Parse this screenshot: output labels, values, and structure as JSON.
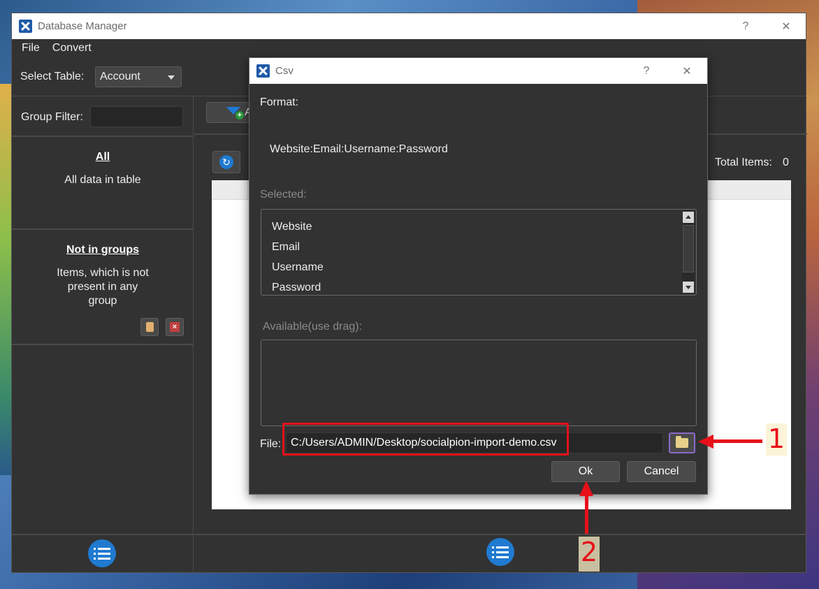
{
  "main_window": {
    "title": "Database Manager",
    "help": "?",
    "close": "✕",
    "menu": [
      "File",
      "Convert"
    ],
    "select_table_label": "Select Table:",
    "select_table_value": "Account",
    "group_filter_label": "Group Filter:",
    "filter_button_text": "A",
    "total_items_label": "Total Items:",
    "total_items_value": "0",
    "groups": [
      {
        "title": "All",
        "desc": "All data in table"
      },
      {
        "title": "Not in groups",
        "desc": "Items, which is not present in any group"
      }
    ]
  },
  "dialog": {
    "title": "Csv",
    "help": "?",
    "close": "✕",
    "format_label": "Format:",
    "format_value": "Website:Email:Username:Password",
    "selected_label": "Selected:",
    "selected_items": [
      "Website",
      "Email",
      "Username",
      "Password"
    ],
    "available_label": "Available(use drag):",
    "file_label": "File:",
    "file_value": "C:/Users/ADMIN/Desktop/socialpion-import-demo.csv",
    "ok_label": "Ok",
    "cancel_label": "Cancel"
  },
  "annotations": {
    "step1": "1",
    "step2": "2",
    "color": "#e8101a"
  },
  "icons": {
    "app": "app-logo-icon",
    "refresh": "refresh-icon",
    "list": "list-icon",
    "folder": "folder-icon",
    "funnel": "filter-add-icon",
    "clipboard": "clipboard-icon",
    "delete": "delete-icon"
  }
}
